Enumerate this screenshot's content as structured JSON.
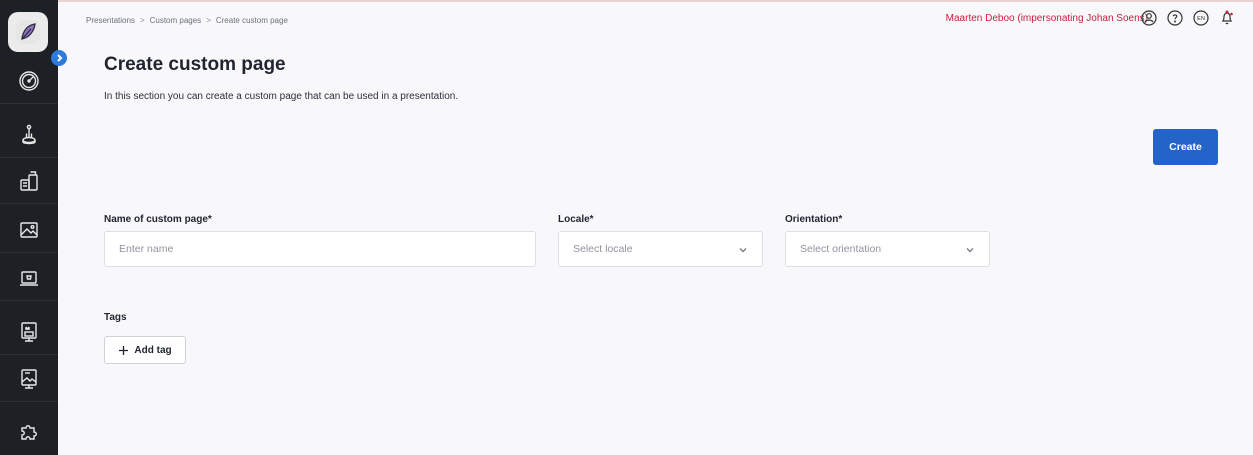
{
  "breadcrumb": [
    "Presentations",
    "Custom pages",
    "Create custom page"
  ],
  "breadcrumb_separator": ">",
  "header": {
    "user": "Maarten Deboo (impersonating Johan Soens)",
    "language": "EN",
    "icons": [
      "profile-icon",
      "help-icon",
      "language-icon",
      "notification-bell-icon"
    ]
  },
  "sidebar": {
    "icons": [
      "dashboard-gauge-icon",
      "joystick-icon",
      "products-icon",
      "image-library-icon",
      "laptop-cart-icon",
      "presentation-m-icon",
      "presentation-image-icon",
      "puzzle-icon"
    ]
  },
  "page": {
    "title": "Create custom page",
    "subtitle": "In this section you can create a custom page that can be used in a presentation.",
    "create_label": "Create"
  },
  "form": {
    "name_label": "Name of custom page*",
    "name_placeholder": "Enter name",
    "locale_label": "Locale*",
    "locale_placeholder": "Select locale",
    "orientation_label": "Orientation*",
    "orientation_placeholder": "Select orientation",
    "tags_label": "Tags",
    "add_tag_label": "Add tag"
  },
  "colors": {
    "primary": "#2463c8",
    "sidebar": "#1d2024",
    "user_text": "#c41f3e",
    "background": "#f8f8fa"
  }
}
